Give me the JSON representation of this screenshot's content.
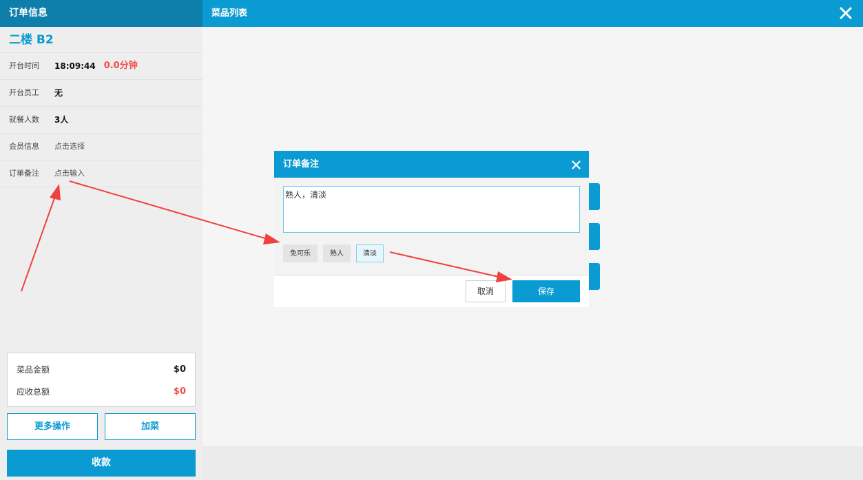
{
  "left_panel": {
    "header": "订单信息",
    "table_name": "二楼 B2",
    "rows": [
      {
        "label": "开台时间",
        "value": "18:09:44",
        "extra": "0.0分钟"
      },
      {
        "label": "开台员工",
        "value": "无"
      },
      {
        "label": "就餐人数",
        "value": "3人"
      },
      {
        "label": "会员信息",
        "value": "点击选择"
      },
      {
        "label": "订单备注",
        "value": "点击输入"
      }
    ],
    "totals": {
      "dish_amount_label": "菜品金额",
      "dish_amount": "$0",
      "total_due_label": "应收总额",
      "total_due": "$0"
    },
    "buttons": {
      "more": "更多操作",
      "add_dish": "加菜",
      "checkout": "收款"
    }
  },
  "right_panel": {
    "header": "菜品列表"
  },
  "modal": {
    "title": "订单备注",
    "remark_value": "熟人，清淡",
    "tags": [
      "免可乐",
      "熟人",
      "清淡"
    ],
    "active_tag": "清淡",
    "cancel": "取消",
    "save": "保存"
  },
  "colors": {
    "accent": "#0a9bd2",
    "header_dark": "#0e7fab",
    "alert_red": "#f0504d",
    "annotation_arrow": "#f04040"
  }
}
